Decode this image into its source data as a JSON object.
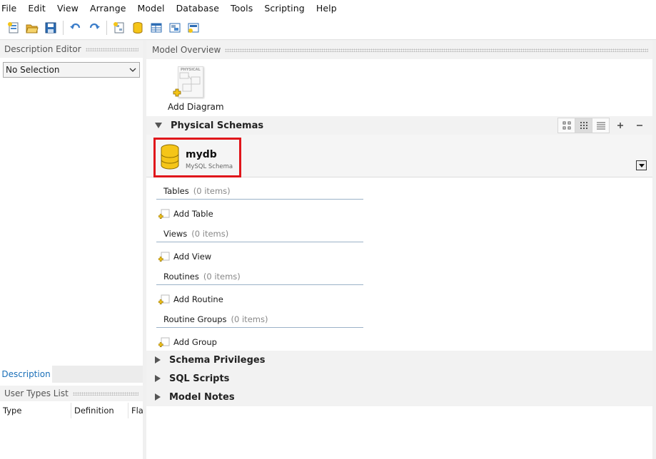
{
  "menu": [
    "File",
    "Edit",
    "View",
    "Arrange",
    "Model",
    "Database",
    "Tools",
    "Scripting",
    "Help"
  ],
  "toolbar": {
    "icons": [
      "new-model-icon",
      "open-model-icon",
      "save-model-icon",
      "undo-icon",
      "redo-icon",
      "new-diagram-icon",
      "new-schema-icon",
      "new-table-icon",
      "new-view-icon",
      "new-routine-icon"
    ]
  },
  "left_panel": {
    "title": "Description Editor",
    "selection": "No Selection",
    "tab_label": "Description",
    "user_types_title": "User Types List",
    "columns": [
      "Type",
      "Definition",
      "Flags"
    ]
  },
  "main": {
    "title": "Model Overview",
    "add_diagram_label": "Add Diagram",
    "diagram_thumb_label": "PHYSICAL",
    "physical_schemas_label": "Physical Schemas",
    "schema": {
      "name": "mydb",
      "subtitle": "MySQL Schema"
    },
    "groups": [
      {
        "label": "Tables",
        "count": "(0 items)",
        "add_label": "Add Table"
      },
      {
        "label": "Views",
        "count": "(0 items)",
        "add_label": "Add View"
      },
      {
        "label": "Routines",
        "count": "(0 items)",
        "add_label": "Add Routine"
      },
      {
        "label": "Routine Groups",
        "count": "(0 items)",
        "add_label": "Add Group"
      }
    ],
    "collapsed_sections": [
      "Schema Privileges",
      "SQL Scripts",
      "Model Notes"
    ]
  },
  "colors": {
    "highlight_border": "#e0161b",
    "tab_text": "#1a6fb8",
    "schema_icon_fill": "#f5c518"
  }
}
